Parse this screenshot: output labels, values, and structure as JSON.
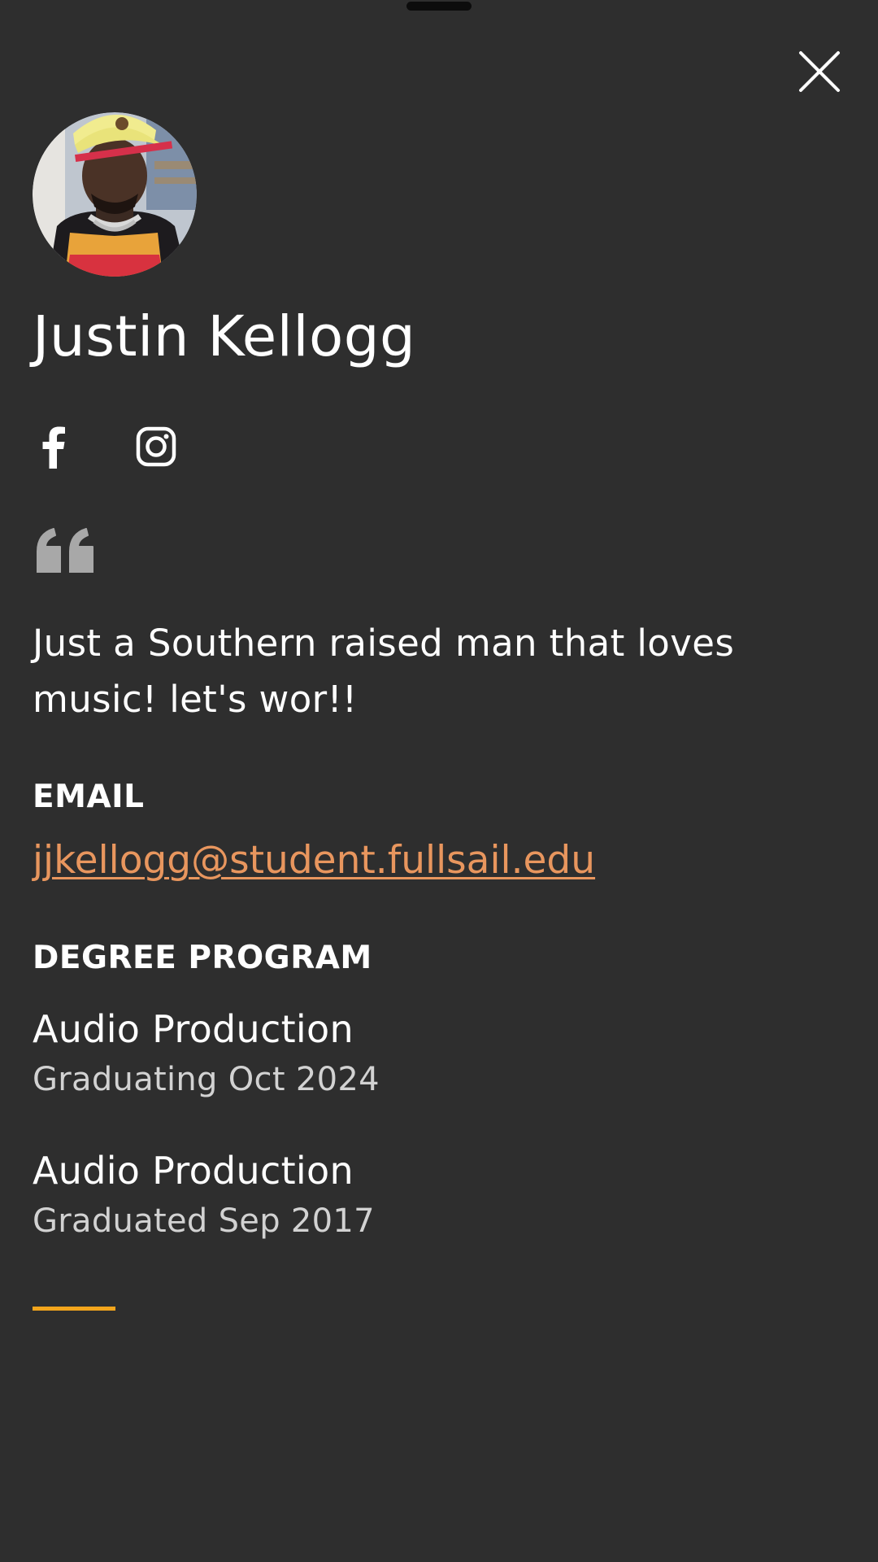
{
  "profile": {
    "name": "Justin Kellogg",
    "bio": "Just a Southern raised man that loves music! let's wor!!"
  },
  "icons": {
    "close": "close-icon",
    "avatar": "profile-photo",
    "facebook": "facebook-icon",
    "instagram": "instagram-icon",
    "quote": "quote-icon"
  },
  "email": {
    "label": "EMAIL",
    "address": "jjkellogg@student.fullsail.edu"
  },
  "degree": {
    "label": "DEGREE PROGRAM",
    "programs": [
      {
        "name": "Audio Production",
        "status": "Graduating Oct 2024"
      },
      {
        "name": "Audio Production",
        "status": "Graduated Sep 2017"
      }
    ]
  },
  "colors": {
    "background": "#2e2e2e",
    "link": "#e8965e",
    "accent": "#f2a51c",
    "quote_icon": "#a8a8a8",
    "secondary_text": "#d2d2d2"
  }
}
